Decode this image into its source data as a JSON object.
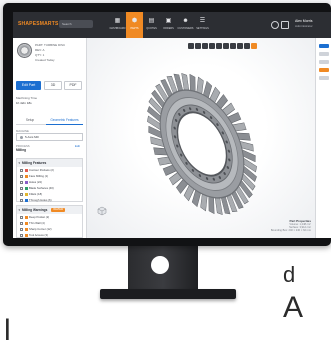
{
  "backdrop": {
    "text_1": "d",
    "text_2": "A",
    "text_3": "l"
  },
  "app": {
    "logo": "SHAPESMARTS",
    "search_placeholder": "Search",
    "nav": [
      {
        "label": "DASHBOARD",
        "icon": "grid-icon"
      },
      {
        "label": "PARTS",
        "icon": "cube-icon"
      },
      {
        "label": "QUOTES",
        "icon": "document-icon"
      },
      {
        "label": "ORDERS",
        "icon": "box-icon"
      },
      {
        "label": "CUSTOMERS",
        "icon": "users-icon"
      },
      {
        "label": "SETTINGS",
        "icon": "sliders-icon"
      }
    ],
    "active_nav": 1,
    "user": {
      "name": "Alex Morris",
      "role": "Administrator"
    }
  },
  "sidebar": {
    "part_lines": [
      "PART: TURBINE DISC",
      "REV: A",
      "QTY: 1",
      "Created Today"
    ],
    "primary_button": "Edit Part",
    "secondary_buttons": [
      "3D",
      "PDF"
    ],
    "meta": [
      "Machining Time",
      "1h 42m 18s"
    ],
    "tabs": [
      "Setup",
      "Geometric Features"
    ],
    "active_tab": 1,
    "field_label": "MACHINE",
    "field_value": "5-Axis Mill",
    "process_label": "PROCESS",
    "process_value": "Milling",
    "process_link": "Edit",
    "milling_features": {
      "title": "Milling Features",
      "rows": [
        {
          "label": "Contour Pockets (2)",
          "color": "#e05a4f"
        },
        {
          "label": "Face Milling (1)",
          "color": "#f08a24"
        },
        {
          "label": "Holes (24)",
          "color": "#8b5fc9"
        },
        {
          "label": "Blade Surfaces (40)",
          "color": "#2f9e6b"
        },
        {
          "label": "Fillets (18)",
          "color": "#e0b62f"
        },
        {
          "label": "Through Holes (6)",
          "color": "#1c6fd1"
        }
      ]
    },
    "milling_warnings": {
      "title": "Milling Warnings",
      "badge": "REVIEW",
      "rows": [
        {
          "label": "Deep Pocket (2)",
          "color": "#f08a24"
        },
        {
          "label": "Thin Wall (4)",
          "color": "#f08a24"
        },
        {
          "label": "Sharp Corner (12)",
          "color": "#f08a24"
        },
        {
          "label": "Tool Access (3)",
          "color": "#f08a24"
        },
        {
          "label": "Small Radius (8)",
          "color": "#f08a24"
        }
      ]
    }
  },
  "viewport": {
    "info_title": "Part Properties",
    "info_lines": [
      "Volume: 1,248 cm³",
      "Surface: 3,912 cm²",
      "Bounding Box: 240 × 240 × 62 mm"
    ]
  },
  "colors": {
    "accent": "#f08a24",
    "primary": "#1c6fd1",
    "topbar": "#2c2e33",
    "part": "#8e9196"
  }
}
